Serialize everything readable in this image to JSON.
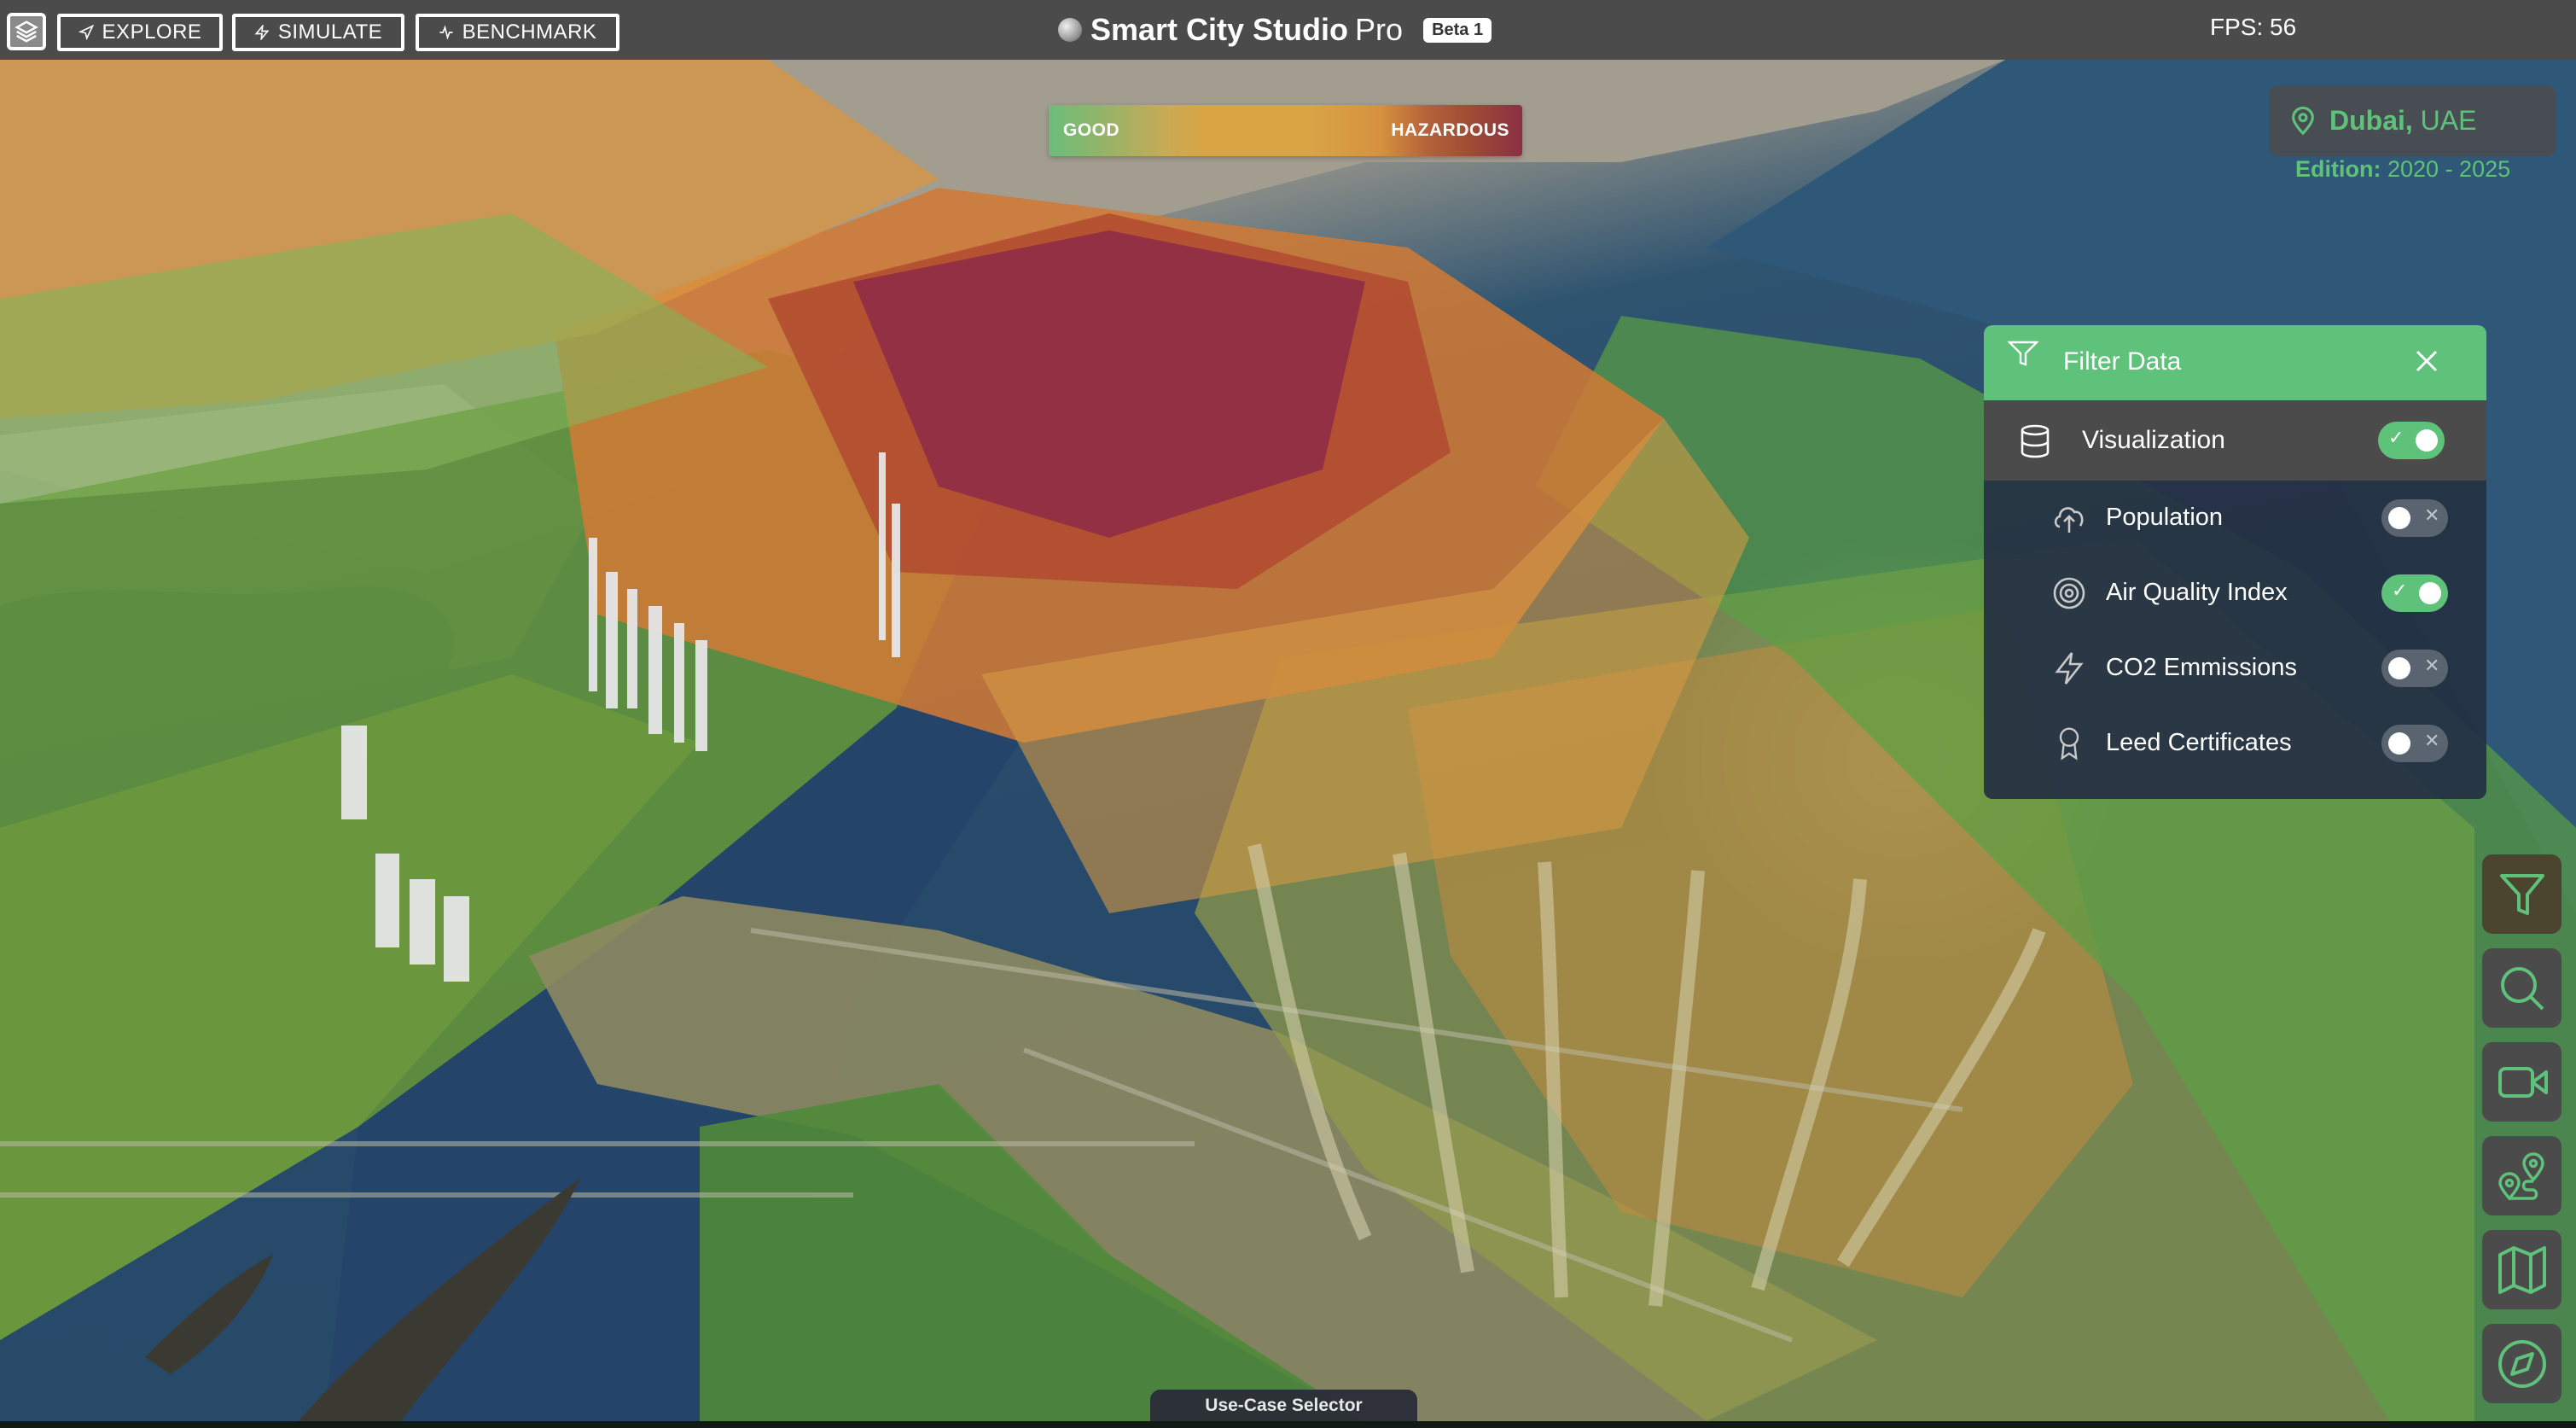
{
  "topbar": {
    "logo_icon": "layers-icon",
    "nav": [
      {
        "label": "EXPLORE",
        "icon": "navigation-arrow-icon"
      },
      {
        "label": "SIMULATE",
        "icon": "lightning-icon"
      },
      {
        "label": "BENCHMARK",
        "icon": "activity-icon"
      }
    ],
    "app_title_bold": "Smart City Studio",
    "app_title_light": "Pro",
    "beta_badge": "Beta 1",
    "fps_label": "FPS: 56"
  },
  "aqi_legend": {
    "low_label": "GOOD",
    "high_label": "HAZARDOUS",
    "colors": [
      "#6cbd7c",
      "#d9a444",
      "#a14e33",
      "#8a3045"
    ]
  },
  "location": {
    "city": "Dubai,",
    "country": "UAE",
    "edition_label": "Edition:",
    "edition_value": "2020 - 2025"
  },
  "filter_panel": {
    "title": "Filter Data",
    "visualization": {
      "label": "Visualization",
      "icon": "database-icon",
      "enabled": true
    },
    "layers": [
      {
        "label": "Population",
        "icon": "cloud-upload-icon",
        "enabled": false
      },
      {
        "label": "Air Quality Index",
        "icon": "target-icon",
        "enabled": true
      },
      {
        "label": "CO2 Emmissions",
        "icon": "lightning-icon",
        "enabled": false
      },
      {
        "label": "Leed Certificates",
        "icon": "award-icon",
        "enabled": false
      }
    ],
    "toggle_on_mark": "✓",
    "toggle_off_mark": "✕"
  },
  "side_toolbar": [
    {
      "name": "filter",
      "icon": "filter-icon",
      "active": true
    },
    {
      "name": "search",
      "icon": "search-icon",
      "active": false
    },
    {
      "name": "camera",
      "icon": "video-camera-icon",
      "active": false
    },
    {
      "name": "route",
      "icon": "route-icon",
      "active": false
    },
    {
      "name": "map",
      "icon": "map-icon",
      "active": false
    },
    {
      "name": "compass",
      "icon": "compass-icon",
      "active": false
    }
  ],
  "bottom": {
    "use_case_selector": "Use-Case Selector"
  },
  "colors": {
    "accent": "#5fc27a",
    "topbar_bg": "#4b4b4b",
    "panel_bg": "#253044"
  }
}
